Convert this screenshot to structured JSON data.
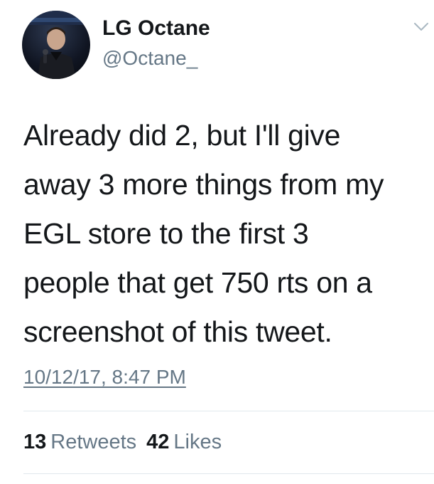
{
  "author": {
    "display_name": "LG Octane",
    "handle": "@Octane_"
  },
  "tweet": {
    "lines": [
      "Already did 2, but I'll give",
      "away 3 more things from my",
      "EGL store to the first 3",
      "people that get 750 rts on a",
      "screenshot of this tweet."
    ],
    "timestamp": "10/12/17, 8:47 PM"
  },
  "stats": {
    "retweets_count": "13",
    "retweets_label": "Retweets",
    "likes_count": "42",
    "likes_label": "Likes"
  },
  "icons": {
    "menu": "chevron-down-icon"
  },
  "colors": {
    "primary_text": "#14171a",
    "secondary_text": "#657786",
    "divider": "#e1e8ed",
    "background": "#ffffff"
  }
}
